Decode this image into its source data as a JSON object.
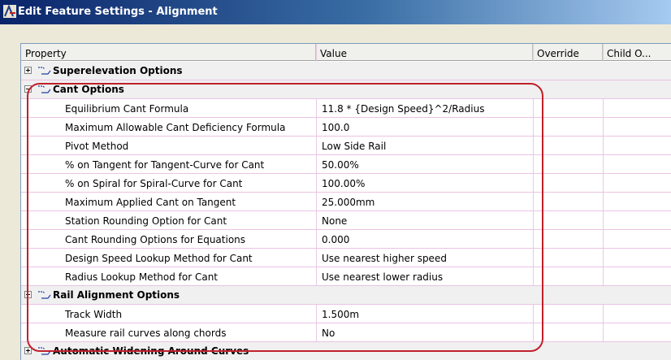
{
  "window": {
    "title": "Edit Feature Settings - Alignment"
  },
  "columns": {
    "property": "Property",
    "value": "Value",
    "override": "Override",
    "child": "Child O..."
  },
  "groups": {
    "superelevation": {
      "label": "Superelevation Options"
    },
    "cant": {
      "label": "Cant Options"
    },
    "rail": {
      "label": "Rail Alignment Options"
    },
    "widening": {
      "label": "Automatic Widening Around Curves"
    }
  },
  "cant_rows": [
    {
      "property": "Equilibrium Cant Formula",
      "value": "11.8 * {Design Speed}^2/Radius"
    },
    {
      "property": "Maximum Allowable Cant Deficiency Formula",
      "value": "100.0"
    },
    {
      "property": "Pivot Method",
      "value": "Low Side Rail"
    },
    {
      "property": "% on Tangent for Tangent-Curve for Cant",
      "value": "50.00%"
    },
    {
      "property": "% on Spiral for Spiral-Curve for Cant",
      "value": "100.00%"
    },
    {
      "property": "Maximum Applied Cant on Tangent",
      "value": "25.000mm"
    },
    {
      "property": "Station Rounding Option for Cant",
      "value": "None"
    },
    {
      "property": "Cant Rounding Options for Equations",
      "value": "0.000"
    },
    {
      "property": "Design Speed Lookup Method for Cant",
      "value": "Use nearest higher speed"
    },
    {
      "property": "Radius Lookup Method for Cant",
      "value": "Use nearest lower radius"
    }
  ],
  "rail_rows": [
    {
      "property": "Track Width",
      "value": "1.500m"
    },
    {
      "property": "Measure rail curves along chords",
      "value": "No"
    }
  ],
  "colors": {
    "highlight": "#C0202A",
    "title_start": "#0A246A",
    "grid_line": "#EBC3E3"
  }
}
